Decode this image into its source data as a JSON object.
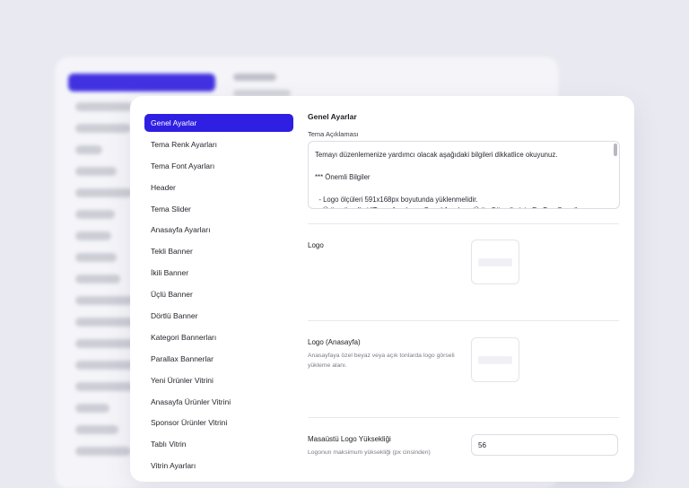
{
  "sidebar": {
    "items": [
      {
        "label": "Genel Ayarlar",
        "active": true
      },
      {
        "label": "Tema Renk Ayarları"
      },
      {
        "label": "Tema Font Ayarları"
      },
      {
        "label": "Header"
      },
      {
        "label": "Tema Slider"
      },
      {
        "label": "Anasayfa Ayarları"
      },
      {
        "label": "Tekli Banner"
      },
      {
        "label": "İkili Banner"
      },
      {
        "label": "Üçlü Banner"
      },
      {
        "label": "Dörtlü Banner"
      },
      {
        "label": "Kategori Bannerları"
      },
      {
        "label": "Parallax Bannerlar"
      },
      {
        "label": "Yeni Ürünler Vitrini"
      },
      {
        "label": "Anasayfa Ürünler Vitrini"
      },
      {
        "label": "Sponsor Ürünler Vitrini"
      },
      {
        "label": "Tablı Vitrin"
      },
      {
        "label": "Vitrin Ayarları"
      }
    ]
  },
  "main": {
    "title": "Genel Ayarlar",
    "description_label": "Tema Açıklaması",
    "description_text": "Temayı düzenlemenize yardımcı olacak aşağıdaki bilgileri dikkatlice okuyunuz.\n\n*** Önemli Bilgiler\n\n  - Logo ölçüleri 591x168px boyutunda yüklenmelidir.\n  - Ürün görselleri \"Tema Ayarları > Genel Ayarlar > Ürün Görsellerinin En-Boy Oranı\"",
    "logo": {
      "label": "Logo"
    },
    "logo_home": {
      "label": "Logo (Anasayfa)",
      "description": "Anasayfaya özel beyaz veya açık tonlarda logo görseli yükleme alanı."
    },
    "desktop_logo_height": {
      "label": "Masaüstü Logo Yüksekliği",
      "description": "Logonun maksimum yüksekliği (px cinsinden)",
      "value": "56"
    }
  },
  "colors": {
    "accent": "#2e1fe2",
    "background": "#e9eaf1"
  }
}
